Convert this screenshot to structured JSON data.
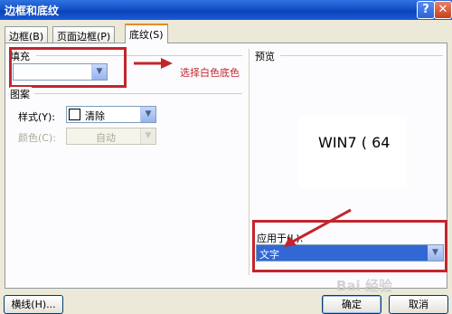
{
  "window": {
    "title": "边框和底纹",
    "help": "?",
    "close": "✕"
  },
  "tabs": [
    {
      "label": "边框(B)"
    },
    {
      "label": "页面边框(P)"
    },
    {
      "label": "底纹(S)"
    }
  ],
  "fill": {
    "label": "填充",
    "value": ""
  },
  "pattern": {
    "label": "图案",
    "style_label": "样式(Y):",
    "style_value": "清除",
    "color_label": "颜色(C):",
    "color_value": "自动"
  },
  "preview": {
    "label": "预览",
    "sample_text": "WIN7 ( 64"
  },
  "apply_to": {
    "label": "应用于(L):",
    "value": "文字"
  },
  "annotation": {
    "text": "选择白色底色",
    "color": "#c2252d"
  },
  "buttons": {
    "lines": "横线(H)...",
    "ok": "确定",
    "cancel": "取消"
  },
  "watermark": {
    "text": "Bai 经验"
  },
  "colors": {
    "title_bar": "#0a43b7",
    "highlight": "#3168d5",
    "dialog_bg": "#ece9d8",
    "panel_bg": "#fcfcfe"
  }
}
